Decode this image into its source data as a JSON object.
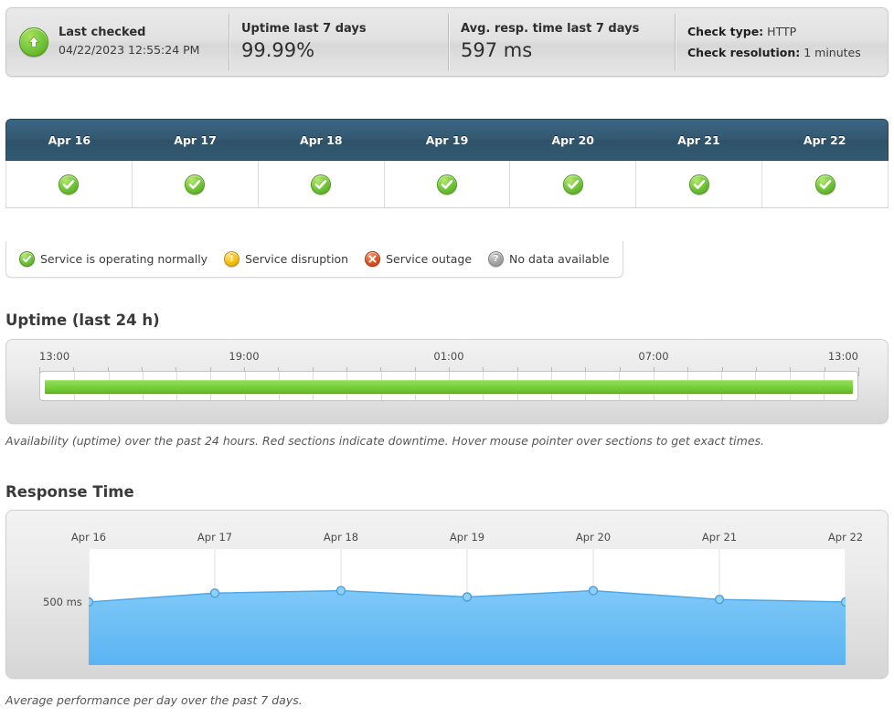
{
  "summary": {
    "last_checked": {
      "icon": "up-arrow-icon",
      "label": "Last checked",
      "value": "04/22/2023 12:55:24 PM"
    },
    "uptime": {
      "label": "Uptime last 7 days",
      "value": "99.99%"
    },
    "resp_time": {
      "label": "Avg. resp. time last 7 days",
      "value": "597 ms"
    },
    "check_type": {
      "label": "Check type:",
      "value": "HTTP"
    },
    "check_resolution": {
      "label": "Check resolution:",
      "value": "1 minutes"
    }
  },
  "day_strip": {
    "days": [
      {
        "label": "Apr 16",
        "status": "ok"
      },
      {
        "label": "Apr 17",
        "status": "ok"
      },
      {
        "label": "Apr 18",
        "status": "ok"
      },
      {
        "label": "Apr 19",
        "status": "ok"
      },
      {
        "label": "Apr 20",
        "status": "ok"
      },
      {
        "label": "Apr 21",
        "status": "ok"
      },
      {
        "label": "Apr 22",
        "status": "ok"
      }
    ]
  },
  "legend": {
    "items": [
      {
        "icon": "check-circle-icon",
        "status": "ok",
        "label": "Service is operating normally"
      },
      {
        "icon": "warning-circle-icon",
        "status": "warn",
        "label": "Service disruption"
      },
      {
        "icon": "error-circle-icon",
        "status": "err",
        "label": "Service outage"
      },
      {
        "icon": "question-circle-icon",
        "status": "none",
        "label": "No data available"
      }
    ]
  },
  "uptime_section": {
    "title": "Uptime (last 24 h)",
    "caption": "Availability (uptime) over the past 24 hours. Red sections indicate downtime. Hover mouse pointer over sections to get exact times."
  },
  "response_section": {
    "title": "Response Time",
    "caption": "Average performance per day over the past 7 days."
  },
  "colors": {
    "up_green": "#79cf3d",
    "area_blue": "#6ec1f7",
    "line_blue": "#3d9fe0",
    "header_blue": "#34586f",
    "status_ok": "#74c63f",
    "status_warn": "#f6c518",
    "status_err": "#e25627",
    "status_none": "#a8a8a8"
  },
  "chart_data": [
    {
      "type": "bar",
      "name": "uptime-last-24h",
      "title": "Uptime (last 24 h)",
      "xlabel": "",
      "ylabel": "",
      "x_tick_labels": [
        "13:00",
        "19:00",
        "01:00",
        "07:00",
        "13:00"
      ],
      "x_tick_positions_hours": [
        0,
        6,
        12,
        18,
        24
      ],
      "hour_ticks": 25,
      "grid": true,
      "segments": [
        {
          "from": "13:00",
          "to": "13:00",
          "status": "up",
          "fraction": 1.0,
          "color": "#79cf3d"
        }
      ],
      "uptime_percent": 100,
      "legend_position": "above-chart"
    },
    {
      "type": "area",
      "name": "response-time-7-days",
      "title": "Response Time",
      "xlabel": "",
      "ylabel": "ms",
      "categories": [
        "Apr 16",
        "Apr 17",
        "Apr 18",
        "Apr 19",
        "Apr 20",
        "Apr 21",
        "Apr 22"
      ],
      "values": [
        500,
        570,
        590,
        540,
        590,
        520,
        500
      ],
      "y_tick_labels": [
        "500 ms"
      ],
      "y_tick_values": [
        500
      ],
      "ylim": [
        0,
        920
      ],
      "grid": true,
      "markers": true,
      "legend_position": "none",
      "series": [
        {
          "name": "Avg. response time",
          "values": [
            500,
            570,
            590,
            540,
            590,
            520,
            500
          ],
          "color": "#6ec1f7"
        }
      ]
    }
  ]
}
